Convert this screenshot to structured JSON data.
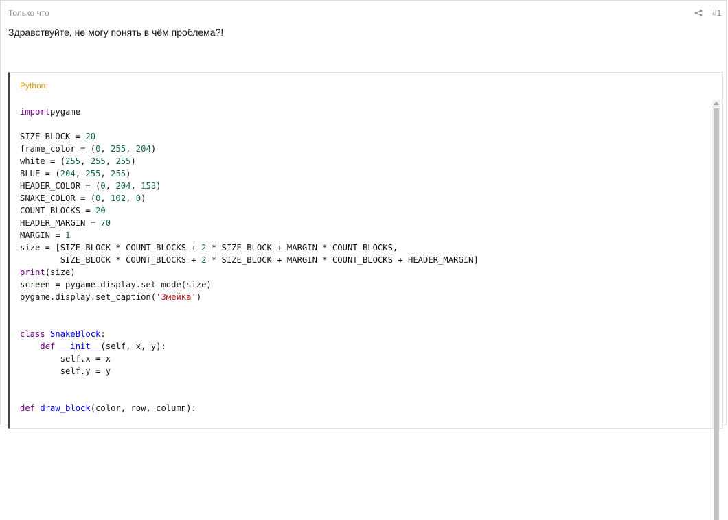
{
  "post": {
    "time": "Только что",
    "number": "#1",
    "share_icon": "share-icon",
    "text": "Здравствуйте, не могу понять в чём проблема?!"
  },
  "code_block": {
    "language": "Python:",
    "lines": [
      [
        [
          "kw",
          "import"
        ],
        [
          "",
          "pygame"
        ]
      ],
      [],
      [
        [
          "",
          "SIZE_BLOCK = "
        ],
        [
          "num",
          "20"
        ]
      ],
      [
        [
          "",
          "frame_color = ("
        ],
        [
          "num",
          "0"
        ],
        [
          "",
          ", "
        ],
        [
          "num",
          "255"
        ],
        [
          "",
          ", "
        ],
        [
          "num",
          "204"
        ],
        [
          "",
          ")"
        ]
      ],
      [
        [
          "",
          "white = ("
        ],
        [
          "num",
          "255"
        ],
        [
          "",
          ", "
        ],
        [
          "num",
          "255"
        ],
        [
          "",
          ", "
        ],
        [
          "num",
          "255"
        ],
        [
          "",
          ")"
        ]
      ],
      [
        [
          "",
          "BLUE = ("
        ],
        [
          "num",
          "204"
        ],
        [
          "",
          ", "
        ],
        [
          "num",
          "255"
        ],
        [
          "",
          ", "
        ],
        [
          "num",
          "255"
        ],
        [
          "",
          ")"
        ]
      ],
      [
        [
          "",
          "HEADER_COLOR = ("
        ],
        [
          "num",
          "0"
        ],
        [
          "",
          ", "
        ],
        [
          "num",
          "204"
        ],
        [
          "",
          ", "
        ],
        [
          "num",
          "153"
        ],
        [
          "",
          ")"
        ]
      ],
      [
        [
          "",
          "SNAKE_COLOR = ("
        ],
        [
          "num",
          "0"
        ],
        [
          "",
          ", "
        ],
        [
          "num",
          "102"
        ],
        [
          "",
          ", "
        ],
        [
          "num",
          "0"
        ],
        [
          "",
          ")"
        ]
      ],
      [
        [
          "",
          "COUNT_BLOCKS = "
        ],
        [
          "num",
          "20"
        ]
      ],
      [
        [
          "",
          "HEADER_MARGIN = "
        ],
        [
          "num",
          "70"
        ]
      ],
      [
        [
          "",
          "MARGIN = "
        ],
        [
          "num",
          "1"
        ]
      ],
      [
        [
          "",
          "size = [SIZE_BLOCK * COUNT_BLOCKS + "
        ],
        [
          "num",
          "2"
        ],
        [
          "",
          " * SIZE_BLOCK + MARGIN * COUNT_BLOCKS,"
        ]
      ],
      [
        [
          "",
          "        SIZE_BLOCK * COUNT_BLOCKS + "
        ],
        [
          "num",
          "2"
        ],
        [
          "",
          " * SIZE_BLOCK + MARGIN * COUNT_BLOCKS + HEADER_MARGIN]"
        ]
      ],
      [
        [
          "kw",
          "print"
        ],
        [
          "",
          "(size)"
        ]
      ],
      [
        [
          "",
          "screen = pygame.display.set_mode(size)"
        ]
      ],
      [
        [
          "",
          "pygame.display.set_caption("
        ],
        [
          "str",
          "'Змейка'"
        ],
        [
          "",
          ")"
        ]
      ],
      [],
      [],
      [
        [
          "kw",
          "class"
        ],
        [
          "",
          ""
        ],
        [
          "def",
          " SnakeBlock"
        ],
        [
          "",
          ":"
        ]
      ],
      [
        [
          "",
          "    "
        ],
        [
          "kw",
          "def"
        ],
        [
          "",
          ""
        ],
        [
          "def",
          " __init__"
        ],
        [
          "",
          "(self, x, y):"
        ]
      ],
      [
        [
          "",
          "        self.x = x"
        ]
      ],
      [
        [
          "",
          "        self.y = y"
        ]
      ],
      [],
      [],
      [
        [
          "kw",
          "def"
        ],
        [
          "def",
          " draw_block"
        ],
        [
          "",
          "(color, row, column):"
        ]
      ]
    ]
  }
}
